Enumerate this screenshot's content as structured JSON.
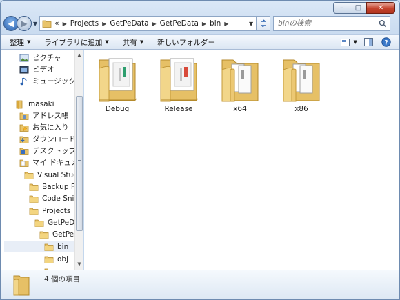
{
  "window": {
    "minimize_glyph": "–",
    "maximize_glyph": "□",
    "close_glyph": "✕"
  },
  "address_bar": {
    "overflow": "«",
    "crumbs": [
      "Projects",
      "GetPeData",
      "GetPeData",
      "bin"
    ],
    "search_placeholder": "binの検索"
  },
  "toolbar": {
    "organize": "整理",
    "add_to_library": "ライブラリに追加",
    "share": "共有",
    "new_folder": "新しいフォルダー"
  },
  "nav_pane": {
    "items": [
      {
        "label": "ピクチャ",
        "icon": "pictures-icon"
      },
      {
        "label": "ビデオ",
        "icon": "video-icon"
      },
      {
        "label": "ミュージック",
        "icon": "music-icon"
      },
      {
        "label": "masaki",
        "icon": "user-folder-icon"
      },
      {
        "label": "アドレス帳",
        "icon": "contacts-icon"
      },
      {
        "label": "お気に入り",
        "icon": "favorites-icon"
      },
      {
        "label": "ダウンロード",
        "icon": "downloads-icon"
      },
      {
        "label": "デスクトップ",
        "icon": "desktop-icon"
      },
      {
        "label": "マイ ドキュメン",
        "icon": "documents-icon"
      },
      {
        "label": "Visual Studio",
        "icon": "folder-icon"
      },
      {
        "label": "Backup Files",
        "icon": "folder-icon"
      },
      {
        "label": "Code Snippe",
        "icon": "folder-icon"
      },
      {
        "label": "Projects",
        "icon": "folder-icon"
      },
      {
        "label": "GetPeData",
        "icon": "folder-icon"
      },
      {
        "label": "GetPeDa",
        "icon": "folder-icon"
      },
      {
        "label": "bin",
        "icon": "folder-icon"
      },
      {
        "label": "obj",
        "icon": "folder-icon"
      }
    ]
  },
  "content": {
    "folders": [
      {
        "name": "Debug",
        "style": "doc"
      },
      {
        "name": "Release",
        "style": "doc"
      },
      {
        "name": "x64",
        "style": "files"
      },
      {
        "name": "x86",
        "style": "files"
      }
    ]
  },
  "details": {
    "item_count": "4 個の項目"
  }
}
